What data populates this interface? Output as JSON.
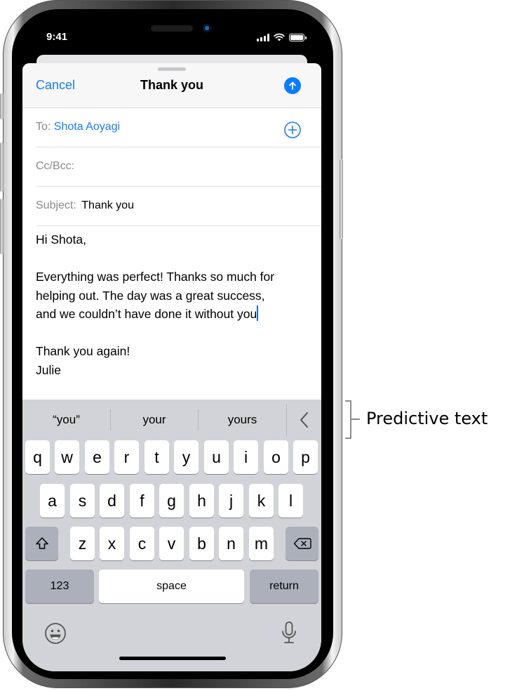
{
  "status_bar": {
    "time": "9:41",
    "icons": [
      "cellular-signal-icon",
      "wifi-icon",
      "battery-icon"
    ]
  },
  "compose": {
    "cancel_label": "Cancel",
    "title": "Thank you",
    "send_icon": "arrow-up-circle-icon",
    "to_label": "To:",
    "to_value": "Shota Aoyagi",
    "add_recipient_icon": "plus-circle-icon",
    "cc_label": "Cc/Bcc:",
    "cc_value": "",
    "subject_label": "Subject:",
    "subject_value": "Thank you",
    "body_lines": [
      "Hi Shota,",
      "",
      "Everything was perfect! Thanks so much for",
      "helping out. The day was a great success,",
      "and we couldn’t have done it without you",
      "",
      "Thank you again!",
      "Julie"
    ]
  },
  "keyboard": {
    "predictions": [
      "“you”",
      "your",
      "yours"
    ],
    "collapse_icon": "chevron-left-icon",
    "row1": [
      "q",
      "w",
      "e",
      "r",
      "t",
      "y",
      "u",
      "i",
      "o",
      "p"
    ],
    "row2": [
      "a",
      "s",
      "d",
      "f",
      "g",
      "h",
      "j",
      "k",
      "l"
    ],
    "row3": [
      "z",
      "x",
      "c",
      "v",
      "b",
      "n",
      "m"
    ],
    "shift_icon": "shift-icon",
    "delete_icon": "delete-backward-icon",
    "numbers_label": "123",
    "space_label": "space",
    "return_label": "return",
    "emoji_icon": "emoji-icon",
    "dictation_icon": "microphone-icon"
  },
  "callout": {
    "label": "Predictive text"
  },
  "colors": {
    "accent": "#1a7cf0",
    "send_button": "#0a7cff",
    "keyboard_bg": "#d2d3d8",
    "dark_key": "#abb0bb"
  }
}
